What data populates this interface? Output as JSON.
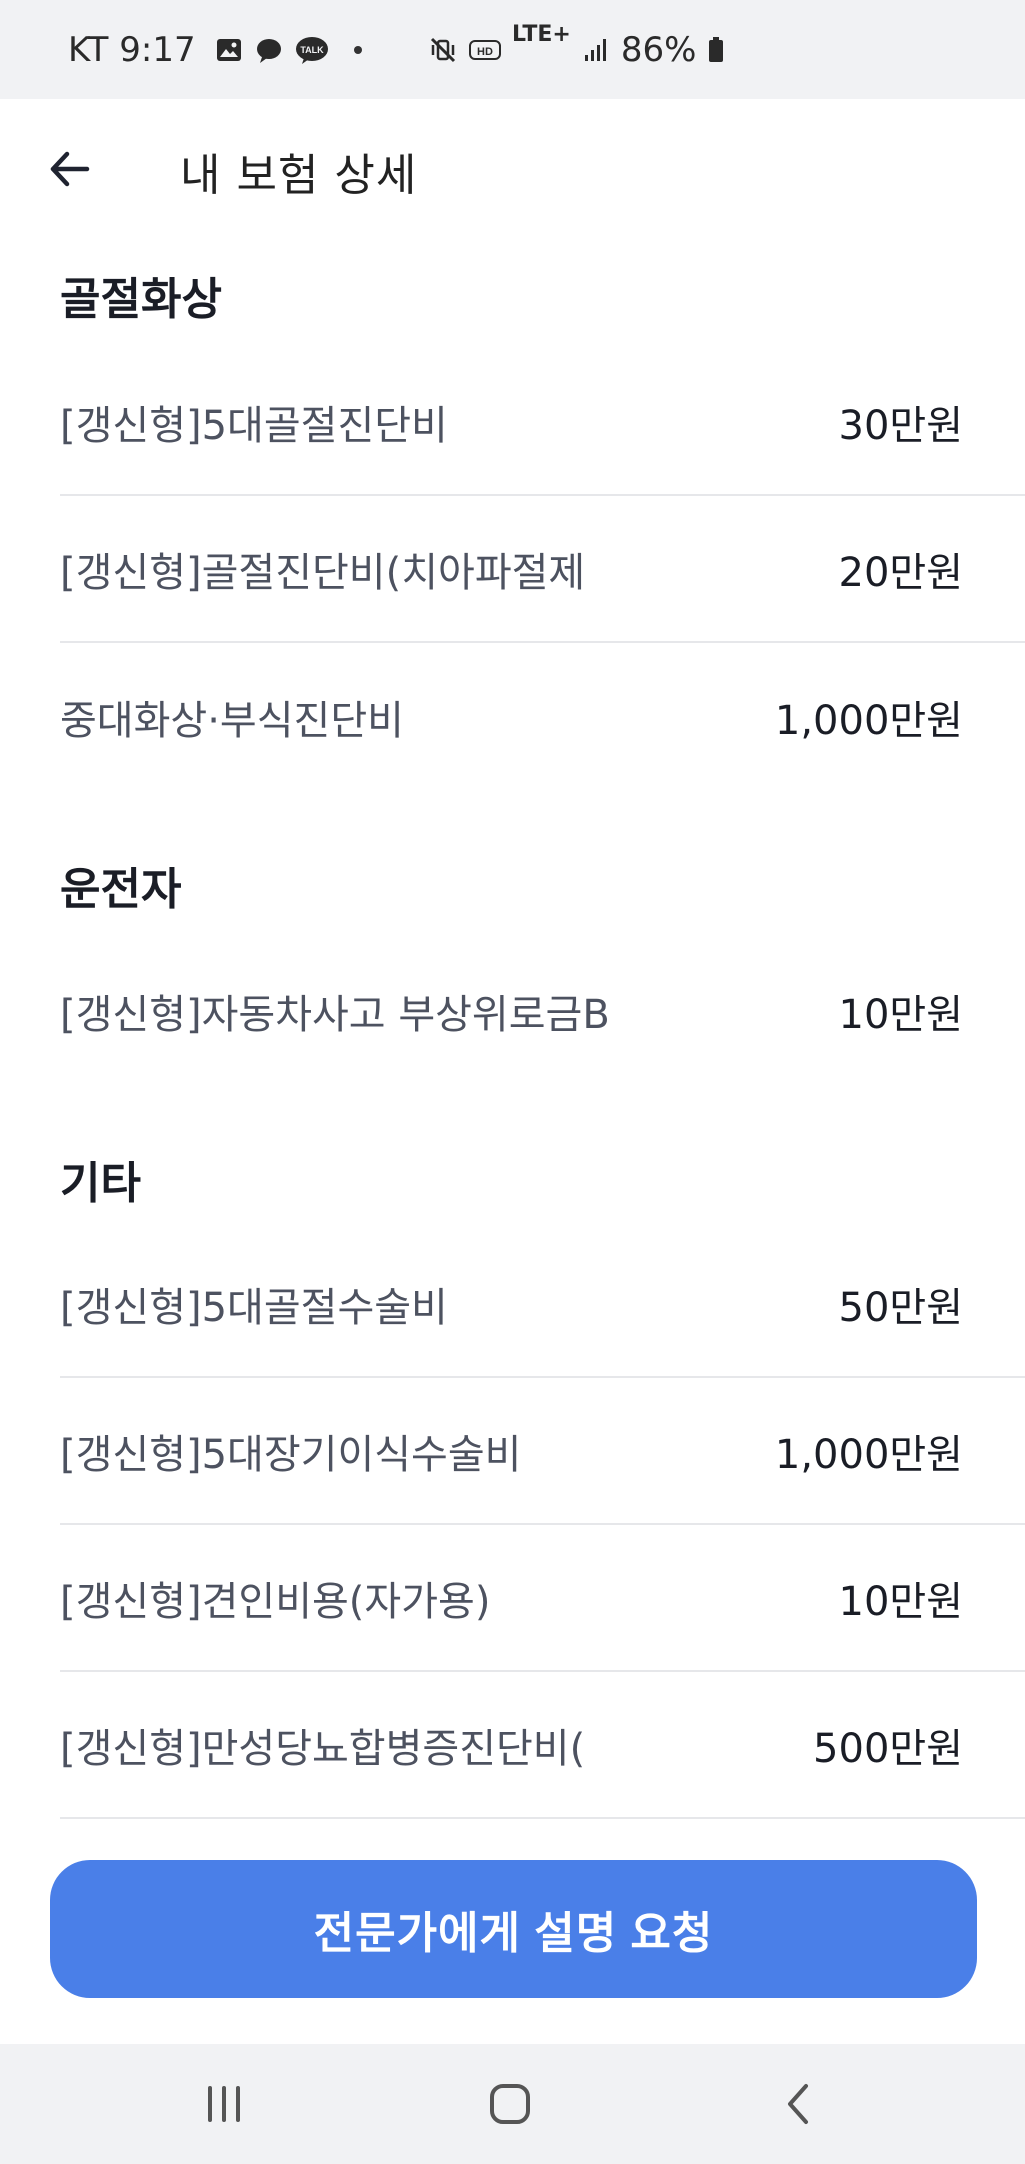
{
  "status_bar": {
    "carrier_time": "KT 9:17",
    "network": "LTE+",
    "battery": "86%"
  },
  "header": {
    "title": "내 보험 상세"
  },
  "sections": [
    {
      "title": "골절화상",
      "items": [
        {
          "name": "[갱신형]5대골절진단비",
          "amount": "30만원"
        },
        {
          "name": "[갱신형]골절진단비(치아파절제",
          "amount": "20만원"
        },
        {
          "name": "중대화상·부식진단비",
          "amount": "1,000만원"
        }
      ]
    },
    {
      "title": "운전자",
      "items": [
        {
          "name": "[갱신형]자동차사고 부상위로금B",
          "amount": "10만원"
        }
      ]
    },
    {
      "title": "기타",
      "items": [
        {
          "name": "[갱신형]5대골절수술비",
          "amount": "50만원"
        },
        {
          "name": "[갱신형]5대장기이식수술비",
          "amount": "1,000만원"
        },
        {
          "name": "[갱신형]견인비용(자가용)",
          "amount": "10만원"
        },
        {
          "name": "[갱신형]만성당뇨합병증진단비(",
          "amount": "500만원"
        }
      ]
    }
  ],
  "cta": {
    "label": "전문가에게 설명 요청",
    "color": "#4a7fe8"
  },
  "icons": {
    "back": "arrow-left-icon",
    "recent": "recent-apps-icon",
    "home": "home-icon",
    "nav_back": "chevron-left-icon"
  }
}
